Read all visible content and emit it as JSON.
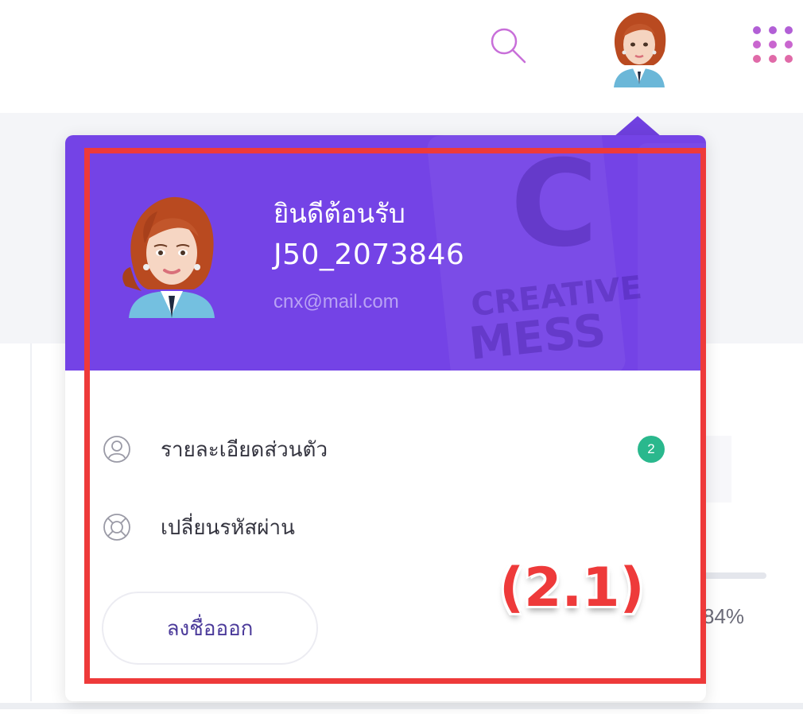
{
  "topbar": {
    "search_icon": "search-icon",
    "avatar_icon": "user-avatar",
    "apps_icon": "apps-grid-icon",
    "accent_color": "#c870e0"
  },
  "background": {
    "progress_text": "84%"
  },
  "profile_menu": {
    "header_color": "#7443e6",
    "welcome": "ยินดีต้อนรับ",
    "username": "J50_2073846",
    "email": "cnx@mail.com",
    "background_text": {
      "letter": "C",
      "line1": "CREATIVE",
      "line2": "MESS"
    },
    "items": [
      {
        "label": "รายละเอียดส่วนตัว",
        "icon": "user-profile-icon",
        "badge": "2"
      },
      {
        "label": "เปลี่ยนรหัสผ่าน",
        "icon": "lifebuoy-icon"
      }
    ],
    "logout_label": "ลงชื่อออก",
    "badge_color": "#2ab88d"
  },
  "annotation": {
    "label": "(2.1)",
    "color": "#ee3a3a"
  }
}
